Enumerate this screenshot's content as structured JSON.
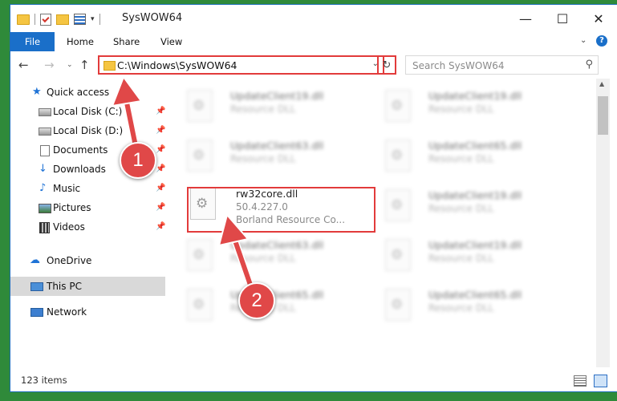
{
  "window": {
    "title": "SysWOW64",
    "minimize_glyph": "—",
    "maximize_glyph": "☐",
    "close_glyph": "✕"
  },
  "ribbon": {
    "tabs": [
      "File",
      "Home",
      "Share",
      "View"
    ],
    "help_glyph": "?",
    "expand_glyph": "⌄"
  },
  "navigation": {
    "back_glyph": "←",
    "forward_glyph": "→",
    "recent_glyph": "⌄",
    "up_glyph": "↑",
    "address": "C:\\Windows\\SysWOW64",
    "address_dropdown_glyph": "⌄",
    "refresh_glyph": "↻",
    "search_placeholder": "Search SysWOW64",
    "search_glyph": "⚲"
  },
  "sidebar": {
    "items": [
      {
        "label": "Quick access",
        "icon": "star-icon",
        "glyph": "★"
      },
      {
        "label": "Local Disk (C:)",
        "icon": "drive-icon",
        "pinned": true
      },
      {
        "label": "Local Disk (D:)",
        "icon": "drive-icon",
        "pinned": true
      },
      {
        "label": "Documents",
        "icon": "document-icon",
        "pinned": true
      },
      {
        "label": "Downloads",
        "icon": "download-icon",
        "glyph": "↓",
        "pinned": true
      },
      {
        "label": "Music",
        "icon": "music-icon",
        "glyph": "♪",
        "pinned": true
      },
      {
        "label": "Pictures",
        "icon": "pictures-icon",
        "pinned": true
      },
      {
        "label": "Videos",
        "icon": "videos-icon",
        "pinned": true
      },
      {
        "label": "OneDrive",
        "icon": "cloud-icon",
        "glyph": "☁"
      },
      {
        "label": "This PC",
        "icon": "computer-icon",
        "selected": true
      },
      {
        "label": "Network",
        "icon": "network-icon"
      }
    ],
    "pin_glyph": "📌"
  },
  "files": {
    "left_column": [
      {
        "name": "UpdateClient19.dll",
        "desc": "Resource DLL"
      },
      {
        "name": "UpdateClient63.dll",
        "desc": "Resource DLL"
      },
      {
        "name": "rw32core.dll",
        "desc": "50.4.227.0",
        "company": "Borland Resource Co..."
      },
      {
        "name": "UpdateClient63.dll",
        "desc": "Resource DLL"
      },
      {
        "name": "UpdateClient65.dll",
        "desc": "Resource DLL"
      }
    ],
    "right_column": [
      {
        "name": "UpdateClient19.dll",
        "desc": "Resource DLL"
      },
      {
        "name": "UpdateClient65.dll",
        "desc": "Resource DLL"
      },
      {
        "name": "UpdateClient19.dll",
        "desc": "Resource DLL"
      },
      {
        "name": "UpdateClient19.dll",
        "desc": "Resource DLL"
      },
      {
        "name": "UpdateClient65.dll",
        "desc": "Resource DLL"
      }
    ]
  },
  "status": {
    "item_count": "123 items"
  },
  "annotations": {
    "step1": "1",
    "step2": "2",
    "color": "#e04848"
  }
}
